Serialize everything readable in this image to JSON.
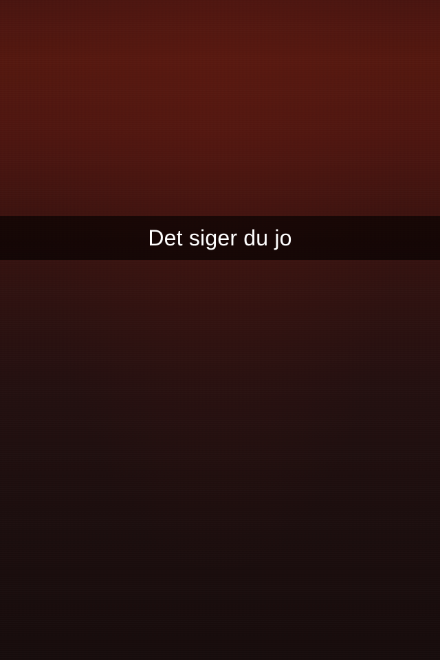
{
  "caption": {
    "text": "Det siger du jo"
  }
}
